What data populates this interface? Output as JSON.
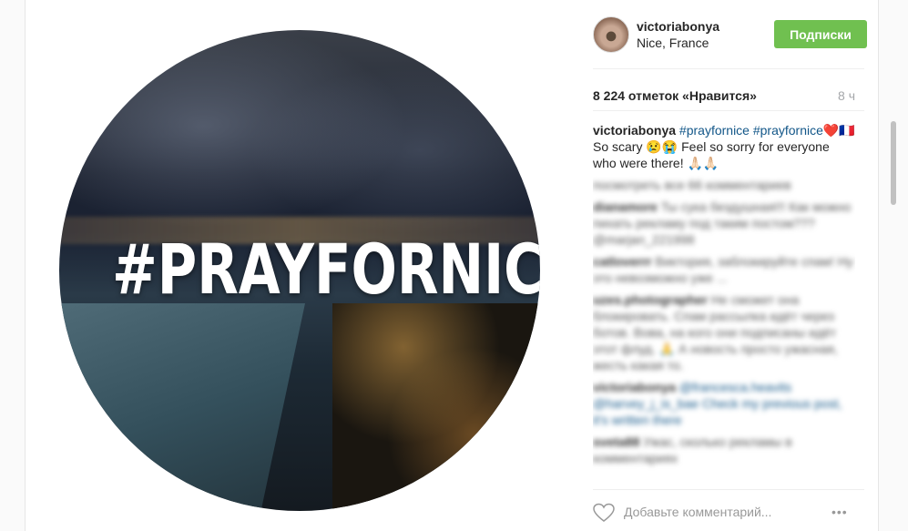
{
  "post": {
    "image_text": "#PRAYFORNICE",
    "username": "victoriabonya",
    "location": "Nice, France",
    "follow_label": "Подписки",
    "likes": "8 224 отметок «Нравится»",
    "time": "8 ч",
    "caption": {
      "username": "victoriabonya",
      "tag1": "#prayfornice",
      "tag2": "#prayfornice",
      "emoji1": "❤️🇫🇷",
      "text1": " So scary ",
      "emoji2": "😢😭",
      "text2": " Feel so sorry for everyone who were there!",
      "emoji3": "🙏🏻🙏🏻"
    },
    "view_all": "посмотреть все 66 комментариев",
    "comments": [
      {
        "user": "dianamore",
        "text": "Ты сука бездушная!!! Как можно пихать рекламу под таким постом??? @marjan_221998"
      },
      {
        "user": "catloverrr",
        "text": "Виктория, заблокируйте спам! Ну это невозможно уже ..."
      },
      {
        "user": "uzes.photographer",
        "text": "Не сможет она блокировать. Спам рассылка идёт через ботов. Вова, на кого они подписаны идёт этот флуд. 🙏 А новость просто ужасная, жесть какая то."
      },
      {
        "user": "victoriabonya",
        "text": "@francesca.heavits @harvey_j_is_bae Check my previous post, it's written there"
      },
      {
        "user": "sveta88",
        "text": "Ужас, сколько рекламы в комментариях"
      }
    ],
    "add_comment_placeholder": "Добавьте комментарий...",
    "more_label": "•••"
  },
  "colors": {
    "follow_bg": "#70c050",
    "link": "#125688",
    "muted": "#a5a7aa"
  }
}
